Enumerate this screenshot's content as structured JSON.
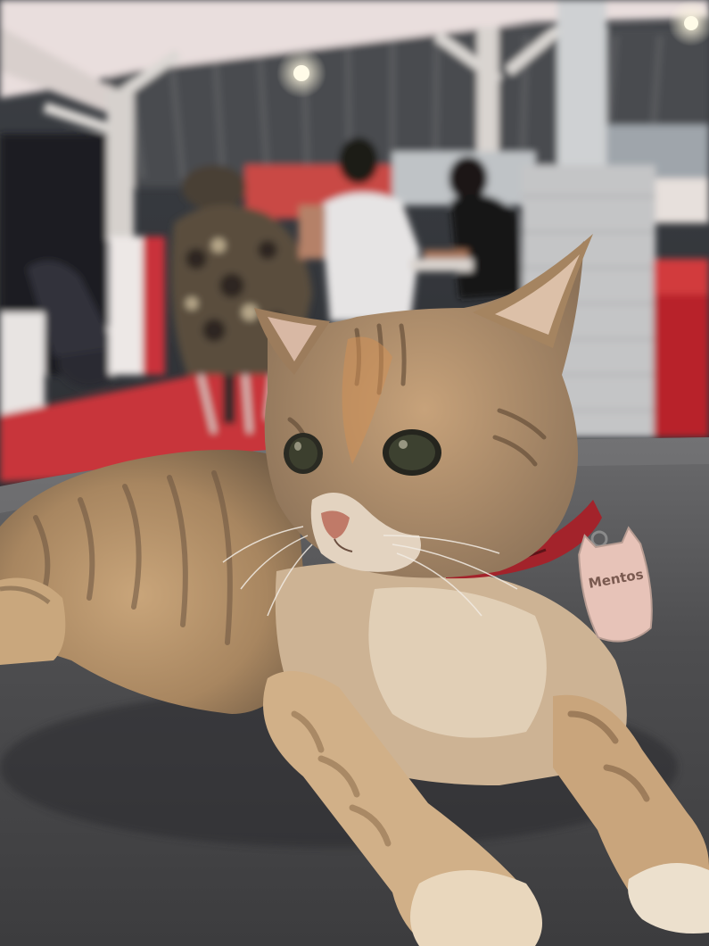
{
  "photo": {
    "tag_text": "Mentos",
    "colors": {
      "table": "#4a4a4c",
      "floor": "#c8363a",
      "roof": "#3a3a3c",
      "cat_fur": "#b8946a",
      "cat_light": "#e8d6b8",
      "collar": "#b0242c",
      "tag": "#e7c3b8"
    }
  }
}
